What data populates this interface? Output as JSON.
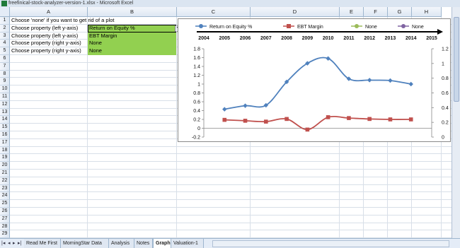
{
  "window": {
    "title": "freefinical-stock-analyzer-version-1.xlsx - Microsoft Excel"
  },
  "columns": [
    "A",
    "B",
    "C",
    "D",
    "E",
    "F",
    "G",
    "H"
  ],
  "rows": [
    "1",
    "2",
    "3",
    "4",
    "5",
    "6",
    "7",
    "8",
    "9",
    "10",
    "11",
    "12",
    "13",
    "14",
    "15",
    "16",
    "17",
    "18",
    "19",
    "20",
    "21",
    "22",
    "23",
    "24",
    "25",
    "26",
    "27",
    "28",
    "29"
  ],
  "cells": {
    "a1": "Choose 'none' if you want to get rid of a plot",
    "a2": "Choose property (left y-axis)",
    "a3": "Choose property (left y-axis)",
    "a4": "Choose property (right y-axis)",
    "a5": "Choose property (right y-axis)",
    "b2": "Return on Equity %",
    "b3": "EBT Margin",
    "b4": "None",
    "b5": "None"
  },
  "colors": {
    "green": "#92d050",
    "series1": "#4f81bd",
    "series2": "#c0504d",
    "series3": "#9bbb59",
    "series4": "#8064a2"
  },
  "sheet_tabs": [
    "Read Me First",
    "MorningStar Data",
    "Analysis",
    "Notes",
    "Graph",
    "Valuation-1"
  ],
  "active_tab": "Graph",
  "chart_data": {
    "type": "line",
    "x": [
      2004,
      2005,
      2006,
      2007,
      2008,
      2009,
      2010,
      2011,
      2012,
      2013,
      2014,
      2015
    ],
    "series": [
      {
        "name": "Return on Equity %",
        "axis": "left",
        "x": [
          2005,
          2006,
          2007,
          2008,
          2009,
          2010,
          2011,
          2012,
          2013,
          2014
        ],
        "values": [
          0.43,
          0.51,
          0.52,
          1.05,
          1.47,
          1.58,
          1.12,
          1.09,
          1.08,
          1.0
        ]
      },
      {
        "name": "EBT Margin",
        "axis": "left",
        "x": [
          2005,
          2006,
          2007,
          2008,
          2009,
          2010,
          2011,
          2012,
          2013,
          2014
        ],
        "values": [
          0.19,
          0.17,
          0.15,
          0.21,
          -0.03,
          0.25,
          0.23,
          0.21,
          0.2,
          0.2
        ]
      },
      {
        "name": "None",
        "axis": "right",
        "x": [],
        "values": []
      },
      {
        "name": "None",
        "axis": "right",
        "x": [],
        "values": []
      }
    ],
    "left_ylim": [
      -0.2,
      1.8
    ],
    "left_yticks": [
      -0.2,
      0,
      0.2,
      0.4,
      0.6,
      0.8,
      1,
      1.2,
      1.4,
      1.6,
      1.8
    ],
    "right_ylim": [
      0,
      1.2
    ],
    "right_yticks": [
      0,
      0.2,
      0.4,
      0.6,
      0.8,
      1,
      1.2
    ],
    "xlim": [
      2004,
      2015
    ],
    "legend": "top",
    "x_axis_position": "top",
    "grid": false
  }
}
